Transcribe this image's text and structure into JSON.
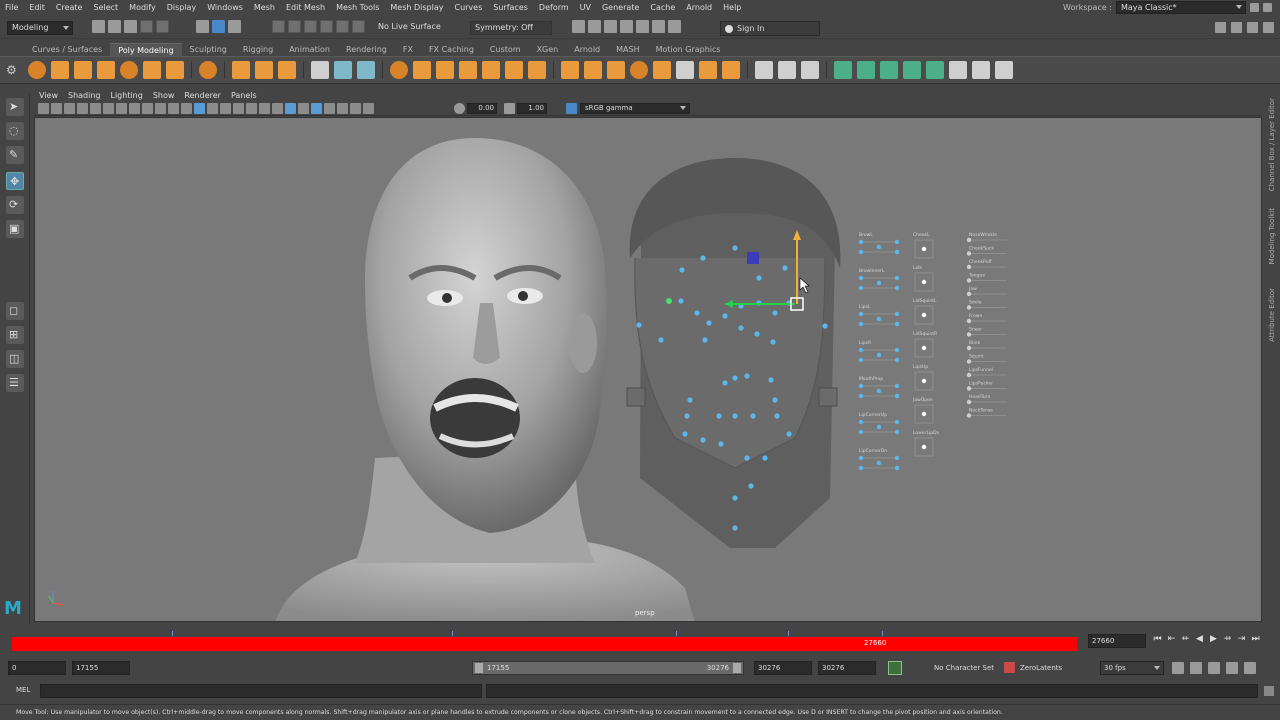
{
  "menubar": {
    "items": [
      "File",
      "Edit",
      "Create",
      "Select",
      "Modify",
      "Display",
      "Windows",
      "Mesh",
      "Edit Mesh",
      "Mesh Tools",
      "Mesh Display",
      "Curves",
      "Surfaces",
      "Deform",
      "UV",
      "Generate",
      "Cache",
      "Arnold",
      "Help"
    ],
    "workspace_label": "Workspace :",
    "workspace_value": "Maya Classic*"
  },
  "statusline": {
    "mode": "Modeling",
    "live_surface": "No Live Surface",
    "symmetry": "Symmetry: Off",
    "sign_in": "Sign In"
  },
  "shelf": {
    "tabs": [
      "Curves / Surfaces",
      "Poly Modeling",
      "Sculpting",
      "Rigging",
      "Animation",
      "Rendering",
      "FX",
      "FX Caching",
      "Custom",
      "XGen",
      "Arnold",
      "MASH",
      "Motion Graphics"
    ],
    "active_tab": "Poly Modeling"
  },
  "panel": {
    "menus": [
      "View",
      "Shading",
      "Lighting",
      "Show",
      "Renderer",
      "Panels"
    ],
    "exposure": "0.00",
    "gamma_value": "1.00",
    "color_space": "sRGB gamma",
    "camera": "persp"
  },
  "side_tabs": [
    "Channel Box / Layer Editor",
    "Modeling Toolkit",
    "Attribute Editor"
  ],
  "facial_ui": {
    "col1": [
      "BrowL",
      "BrowInnerL",
      "LipsL",
      "LipsR",
      "MouthProp",
      "LipCornerUp",
      "LipCornerDn"
    ],
    "col2": [
      "CheekL",
      "Lids",
      "LidSquintL",
      "LidSquintR",
      "LipsUp",
      "JawOpen",
      "LowerLipDn"
    ],
    "col3": [
      "NoseWrinkle",
      "CheekSuck",
      "CheekPuff",
      "Tongue",
      "Jaw",
      "Smile",
      "Frown",
      "Sneer",
      "Blink",
      "Squint",
      "LipsFunnel",
      "LipsPucker",
      "HeadTurn",
      "NeckTense"
    ]
  },
  "timeline": {
    "current_frame": "27660",
    "current_frame_field": "27660"
  },
  "range": {
    "start": "0",
    "playback_start": "17155",
    "range_left": "17155",
    "range_right": "30276",
    "playback_end": "30276",
    "end": "30276",
    "character_set": "No Character Set",
    "anim_layer": "ZeroLatents",
    "fps": "30 fps"
  },
  "command": {
    "label": "MEL"
  },
  "helpline": {
    "text": "Move Tool: Use manipulator to move object(s). Ctrl+middle-drag to move components along normals. Shift+drag manipulator axis or plane handles to extrude components or clone objects. Ctrl+Shift+drag to constrain movement to a connected edge. Use D or INSERT to change the pivot position and axis orientation."
  },
  "colors": {
    "timeline_red": "#ff0000",
    "viewport_bg": "#797979",
    "selection_blue": "#5285a6",
    "control_dot": "#5ab8ee"
  }
}
